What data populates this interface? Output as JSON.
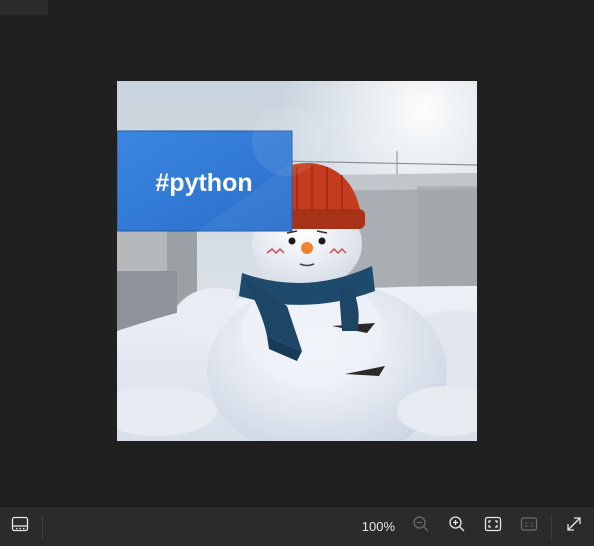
{
  "image": {
    "overlay_tag_text": "#python",
    "overlay_tag_color": "#2f7ad6"
  },
  "toolbar": {
    "zoom_level": "100%",
    "actual_size_label": "1:1",
    "icons": [
      "filmstrip-icon",
      "zoom-out-icon",
      "zoom-in-icon",
      "fit-to-window-icon",
      "actual-size-icon",
      "expand-icon"
    ]
  },
  "colors": {
    "background": "#202020",
    "toolbar": "#2b2b2b",
    "icon": "#e6e6e6",
    "icon_disabled": "#6b6b6b"
  }
}
